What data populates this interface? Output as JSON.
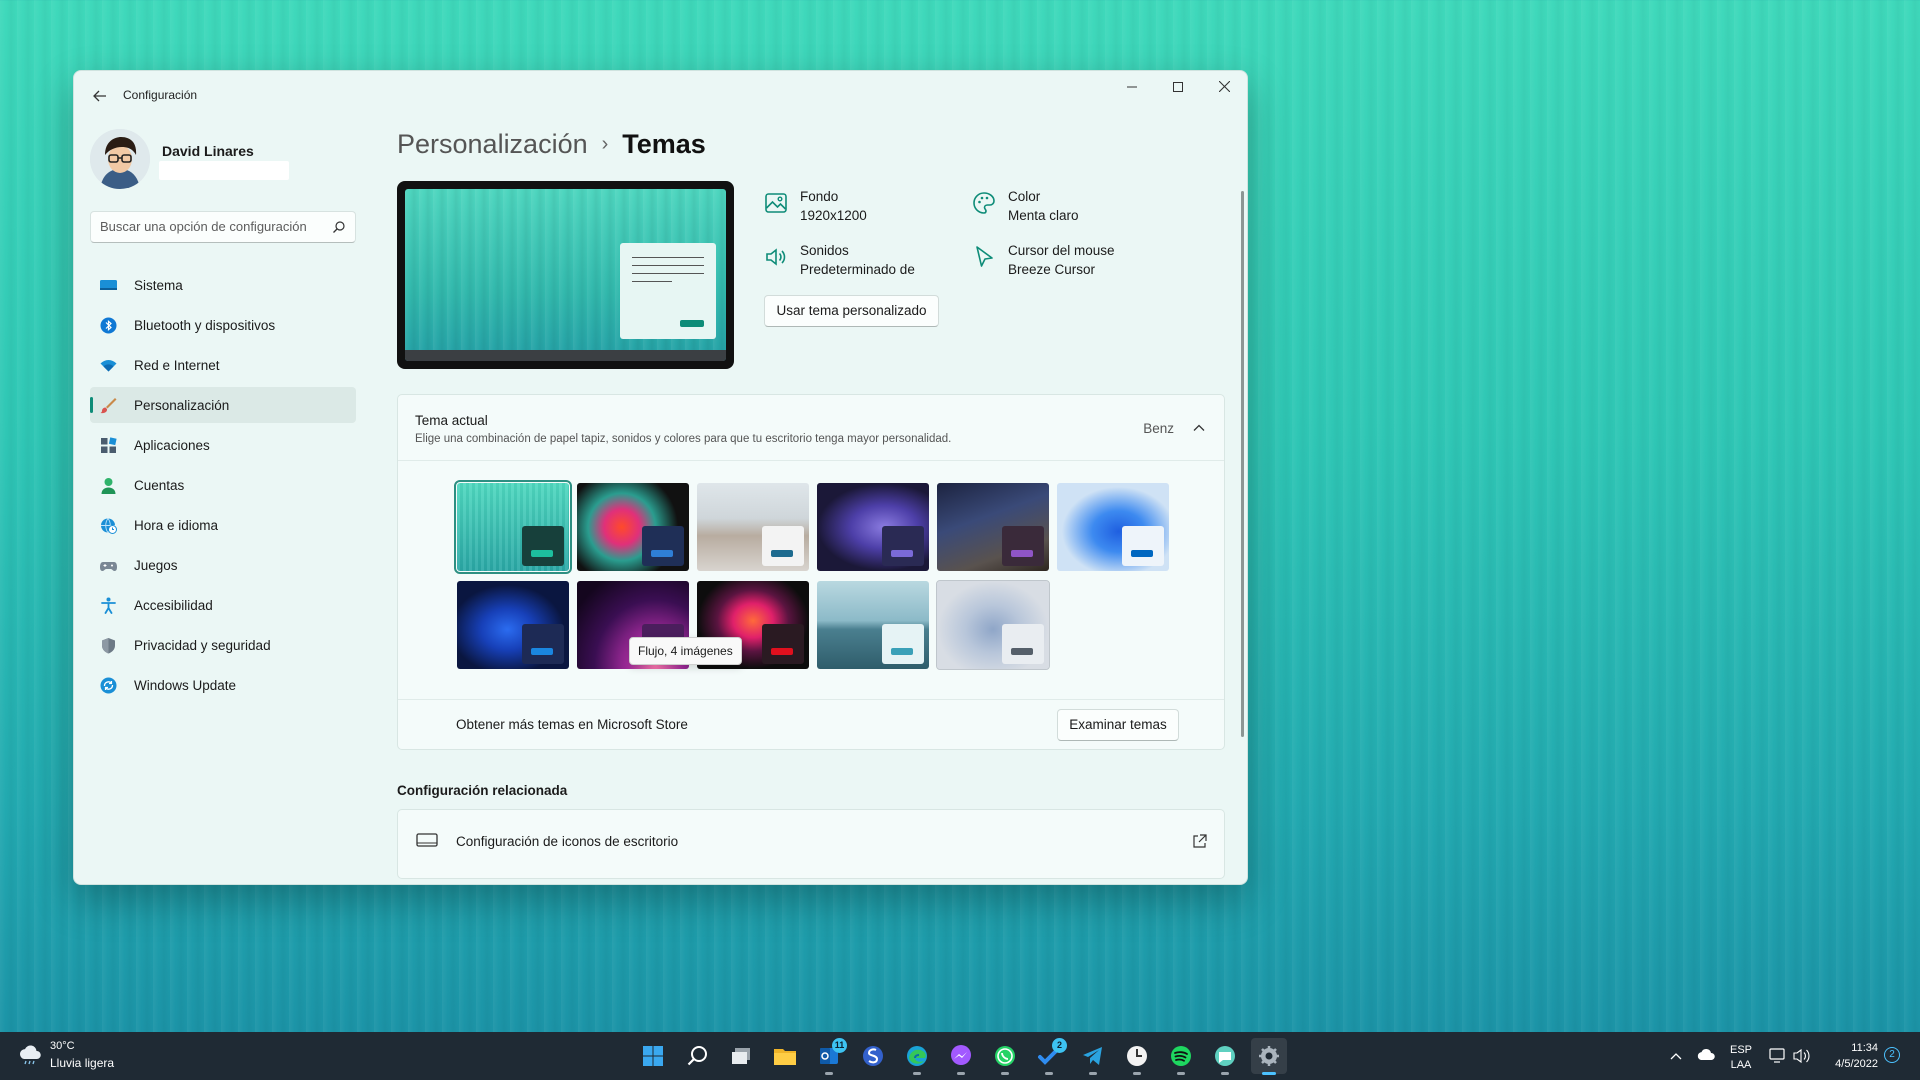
{
  "window": {
    "app_title": "Configuración",
    "user_name": "David Linares",
    "search_placeholder": "Buscar una opción de configuración"
  },
  "nav": {
    "items": [
      {
        "label": "Sistema",
        "icon": "system-icon"
      },
      {
        "label": "Bluetooth y dispositivos",
        "icon": "bluetooth-icon"
      },
      {
        "label": "Red e Internet",
        "icon": "wifi-icon"
      },
      {
        "label": "Personalización",
        "icon": "brush-icon",
        "active": true
      },
      {
        "label": "Aplicaciones",
        "icon": "apps-icon"
      },
      {
        "label": "Cuentas",
        "icon": "person-icon"
      },
      {
        "label": "Hora e idioma",
        "icon": "globe-clock-icon"
      },
      {
        "label": "Juegos",
        "icon": "gamepad-icon"
      },
      {
        "label": "Accesibilidad",
        "icon": "accessibility-icon"
      },
      {
        "label": "Privacidad y seguridad",
        "icon": "shield-icon"
      },
      {
        "label": "Windows Update",
        "icon": "update-icon"
      }
    ]
  },
  "breadcrumb": {
    "parent": "Personalización",
    "separator": "›",
    "current": "Temas"
  },
  "properties": {
    "background_title": "Fondo",
    "background_value": "1920x1200",
    "color_title": "Color",
    "color_value": "Menta claro",
    "sounds_title": "Sonidos",
    "sounds_value": "Predeterminado de",
    "cursor_title": "Cursor del mouse",
    "cursor_value": "Breeze Cursor",
    "custom_theme_button": "Usar tema personalizado"
  },
  "theme_card": {
    "title": "Tema actual",
    "description": "Elige una combinación de papel tapiz, sonidos y colores para que tu escritorio tenga mayor personalidad.",
    "current_value": "Benz",
    "tooltip": "Flujo, 4 imágenes",
    "store_text": "Obtener más temas en Microsoft Store",
    "browse_button": "Examinar temas",
    "themes": [
      {
        "name": "theme-mint",
        "accent": "#0e8c78",
        "selected": true
      },
      {
        "name": "theme-color-burst",
        "accent": "#1a5fb4"
      },
      {
        "name": "theme-desert",
        "accent": "#1e6b8f"
      },
      {
        "name": "theme-purple-bloom",
        "accent": "#6a5acd"
      },
      {
        "name": "theme-night-sky",
        "accent": "#7b3fb0"
      },
      {
        "name": "theme-blue-bloom-light",
        "accent": "#0067c0"
      },
      {
        "name": "theme-blue-bloom-dark",
        "accent": "#0078d4"
      },
      {
        "name": "theme-glow",
        "accent": "#4b1e6d"
      },
      {
        "name": "theme-flower",
        "accent": "#d1001c"
      },
      {
        "name": "theme-lake",
        "accent": "#3aa0b8"
      },
      {
        "name": "theme-flow",
        "accent": "#555f6a"
      }
    ]
  },
  "related": {
    "title": "Configuración relacionada",
    "desktop_icons": "Configuración de iconos de escritorio"
  },
  "taskbar": {
    "weather_temp": "30°C",
    "weather_desc": "Lluvia ligera",
    "messenger_badge": "11",
    "todo_badge": "2",
    "language_top": "ESP",
    "language_bottom": "LAA",
    "time": "11:34",
    "date": "4/5/2022",
    "notifications": "2"
  }
}
